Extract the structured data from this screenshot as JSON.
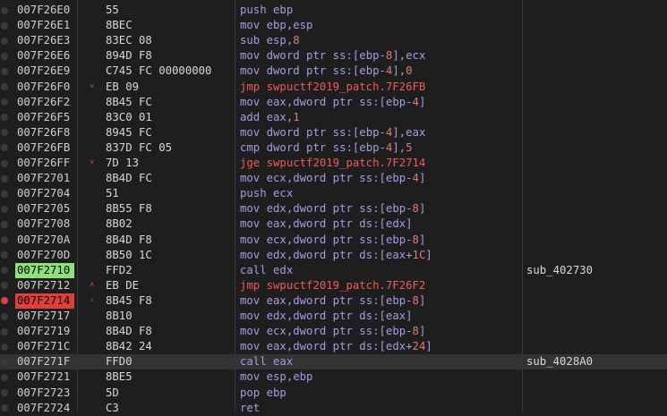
{
  "colors": {
    "background": "#1e1e1e",
    "selected_row": "#333333",
    "eip_highlight": "#8ee27a",
    "breakpoint": "#e0403c",
    "mnemonic": "#a89ae6",
    "jump_mnemonic": "#ef5a5a",
    "number": "#e07a7a"
  },
  "rows": [
    {
      "addr": "007F26E0",
      "bytes": "55",
      "mn": "push",
      "op": "ebp",
      "comment": "",
      "arrow": "",
      "bp": false,
      "eip": false,
      "selected": false,
      "jump": false
    },
    {
      "addr": "007F26E1",
      "bytes": "8BEC",
      "mn": "mov",
      "op": "ebp,esp",
      "comment": "",
      "arrow": "",
      "bp": false,
      "eip": false,
      "selected": false,
      "jump": false
    },
    {
      "addr": "007F26E3",
      "bytes": "83EC 08",
      "mn": "sub",
      "op": "esp,8",
      "comment": "",
      "arrow": "",
      "bp": false,
      "eip": false,
      "selected": false,
      "jump": false
    },
    {
      "addr": "007F26E6",
      "bytes": "894D F8",
      "mn": "mov",
      "op": "dword ptr ss:[ebp-8],ecx",
      "comment": "",
      "arrow": "",
      "bp": false,
      "eip": false,
      "selected": false,
      "jump": false
    },
    {
      "addr": "007F26E9",
      "bytes": "C745 FC 00000000",
      "mn": "mov",
      "op": "dword ptr ss:[ebp-4],0",
      "comment": "",
      "arrow": "",
      "bp": false,
      "eip": false,
      "selected": false,
      "jump": false
    },
    {
      "addr": "007F26F0",
      "bytes": "EB 09",
      "mn": "jmp",
      "op": "swpuctf2019_patch.7F26FB",
      "comment": "",
      "arrow": "v",
      "bp": false,
      "eip": false,
      "selected": false,
      "jump": true
    },
    {
      "addr": "007F26F2",
      "bytes": "8B45 FC",
      "mn": "mov",
      "op": "eax,dword ptr ss:[ebp-4]",
      "comment": "",
      "arrow": "",
      "bp": false,
      "eip": false,
      "selected": false,
      "jump": false
    },
    {
      "addr": "007F26F5",
      "bytes": "83C0 01",
      "mn": "add",
      "op": "eax,1",
      "comment": "",
      "arrow": "",
      "bp": false,
      "eip": false,
      "selected": false,
      "jump": false
    },
    {
      "addr": "007F26F8",
      "bytes": "8945 FC",
      "mn": "mov",
      "op": "dword ptr ss:[ebp-4],eax",
      "comment": "",
      "arrow": "",
      "bp": false,
      "eip": false,
      "selected": false,
      "jump": false
    },
    {
      "addr": "007F26FB",
      "bytes": "837D FC 05",
      "mn": "cmp",
      "op": "dword ptr ss:[ebp-4],5",
      "comment": "",
      "arrow": "",
      "bp": false,
      "eip": false,
      "selected": false,
      "jump": false
    },
    {
      "addr": "007F26FF",
      "bytes": "7D 13",
      "mn": "jge",
      "op": "swpuctf2019_patch.7F2714",
      "comment": "",
      "arrow": "v",
      "bp": false,
      "eip": false,
      "selected": false,
      "jump": true
    },
    {
      "addr": "007F2701",
      "bytes": "8B4D FC",
      "mn": "mov",
      "op": "ecx,dword ptr ss:[ebp-4]",
      "comment": "",
      "arrow": "",
      "bp": false,
      "eip": false,
      "selected": false,
      "jump": false
    },
    {
      "addr": "007F2704",
      "bytes": "51",
      "mn": "push",
      "op": "ecx",
      "comment": "",
      "arrow": "",
      "bp": false,
      "eip": false,
      "selected": false,
      "jump": false
    },
    {
      "addr": "007F2705",
      "bytes": "8B55 F8",
      "mn": "mov",
      "op": "edx,dword ptr ss:[ebp-8]",
      "comment": "",
      "arrow": "",
      "bp": false,
      "eip": false,
      "selected": false,
      "jump": false
    },
    {
      "addr": "007F2708",
      "bytes": "8B02",
      "mn": "mov",
      "op": "eax,dword ptr ds:[edx]",
      "comment": "",
      "arrow": "",
      "bp": false,
      "eip": false,
      "selected": false,
      "jump": false
    },
    {
      "addr": "007F270A",
      "bytes": "8B4D F8",
      "mn": "mov",
      "op": "ecx,dword ptr ss:[ebp-8]",
      "comment": "",
      "arrow": "",
      "bp": false,
      "eip": false,
      "selected": false,
      "jump": false
    },
    {
      "addr": "007F270D",
      "bytes": "8B50 1C",
      "mn": "mov",
      "op": "edx,dword ptr ds:[eax+1C]",
      "comment": "",
      "arrow": "",
      "bp": false,
      "eip": false,
      "selected": false,
      "jump": false
    },
    {
      "addr": "007F2710",
      "bytes": "FFD2",
      "mn": "call",
      "op": "edx",
      "comment": "sub_402730",
      "arrow": "",
      "bp": false,
      "eip": true,
      "selected": false,
      "jump": false
    },
    {
      "addr": "007F2712",
      "bytes": "EB DE",
      "mn": "jmp",
      "op": "swpuctf2019_patch.7F26F2",
      "comment": "",
      "arrow": "^",
      "bp": false,
      "eip": false,
      "selected": false,
      "jump": true
    },
    {
      "addr": "007F2714",
      "bytes": "8B45 F8",
      "mn": "mov",
      "op": "eax,dword ptr ss:[ebp-8]",
      "comment": "",
      "arrow": ">",
      "bp": true,
      "eip": false,
      "selected": false,
      "jump": false
    },
    {
      "addr": "007F2717",
      "bytes": "8B10",
      "mn": "mov",
      "op": "edx,dword ptr ds:[eax]",
      "comment": "",
      "arrow": "",
      "bp": false,
      "eip": false,
      "selected": false,
      "jump": false
    },
    {
      "addr": "007F2719",
      "bytes": "8B4D F8",
      "mn": "mov",
      "op": "ecx,dword ptr ss:[ebp-8]",
      "comment": "",
      "arrow": "",
      "bp": false,
      "eip": false,
      "selected": false,
      "jump": false
    },
    {
      "addr": "007F271C",
      "bytes": "8B42 24",
      "mn": "mov",
      "op": "eax,dword ptr ds:[edx+24]",
      "comment": "",
      "arrow": "",
      "bp": false,
      "eip": false,
      "selected": false,
      "jump": false
    },
    {
      "addr": "007F271F",
      "bytes": "FFD0",
      "mn": "call",
      "op": "eax",
      "comment": "sub_4028A0",
      "arrow": "",
      "bp": false,
      "eip": false,
      "selected": true,
      "jump": false
    },
    {
      "addr": "007F2721",
      "bytes": "8BE5",
      "mn": "mov",
      "op": "esp,ebp",
      "comment": "",
      "arrow": "",
      "bp": false,
      "eip": false,
      "selected": false,
      "jump": false
    },
    {
      "addr": "007F2723",
      "bytes": "5D",
      "mn": "pop",
      "op": "ebp",
      "comment": "",
      "arrow": "",
      "bp": false,
      "eip": false,
      "selected": false,
      "jump": false
    },
    {
      "addr": "007F2724",
      "bytes": "C3",
      "mn": "ret",
      "op": "",
      "comment": "",
      "arrow": "",
      "bp": false,
      "eip": false,
      "selected": false,
      "jump": false
    }
  ]
}
